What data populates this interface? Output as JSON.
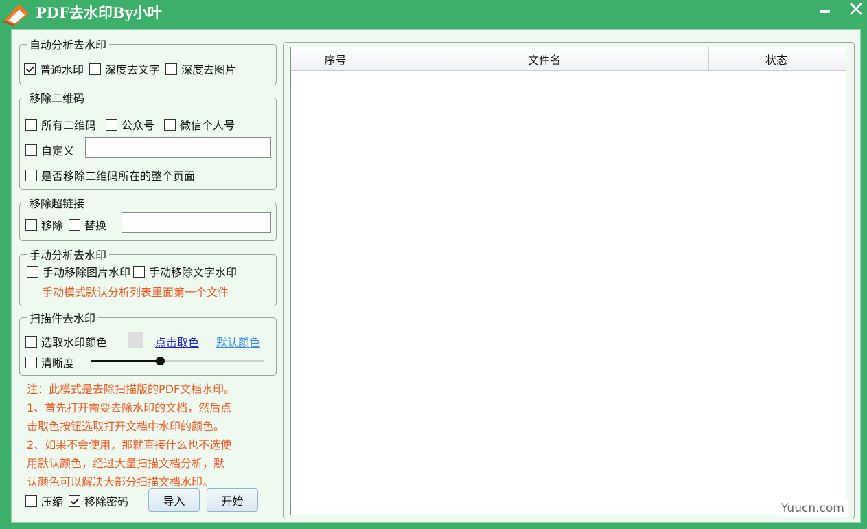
{
  "title": "PDF去水印By小叶",
  "window_controls": {
    "minimize_icon": "minimize-icon",
    "close_icon": "close-icon"
  },
  "groups": {
    "auto": {
      "legend": "自动分析去水印",
      "options": [
        {
          "label": "普通水印",
          "checked": true
        },
        {
          "label": "深度去文字",
          "checked": false
        },
        {
          "label": "深度去图片",
          "checked": false
        }
      ]
    },
    "qrcode": {
      "legend": "移除二维码",
      "options": [
        {
          "label": "所有二维码",
          "checked": false
        },
        {
          "label": "公众号",
          "checked": false
        },
        {
          "label": "微信个人号",
          "checked": false
        }
      ],
      "custom_label": "自定义",
      "custom_value": "",
      "remove_page_label": "是否移除二维码所在的整个页面"
    },
    "hyperlink": {
      "legend": "移除超链接",
      "remove_label": "移除",
      "replace_label": "替换",
      "replace_value": ""
    },
    "manual": {
      "legend": "手动分析去水印",
      "image_label": "手动移除图片水印",
      "text_label": "手动移除文字水印",
      "hint": "手动模式默认分析列表里面第一个文件"
    },
    "scan": {
      "legend": "扫描件去水印",
      "pick_color_label": "选取水印颜色",
      "swatch_color": "#dedede",
      "click_pick_link": "点击取色",
      "default_color_link": "默认颜色",
      "clarity_label": "清晰度",
      "clarity_level": 0.4
    }
  },
  "note": "注：此模式是去除扫描版的PDF文档水印。\n1、首先打开需要去除水印的文档，然后点\n击取色按钮选取打开文档中水印的颜色。\n2、如果不会使用，那就直接什么也不选使\n用默认颜色，经过大量扫描文档分析，默\n认颜色可以解决大部分扫描文档水印。",
  "bottom": {
    "compress_label": "压缩",
    "compress_checked": false,
    "remove_pwd_label": "移除密码",
    "remove_pwd_checked": true,
    "import_label": "导入",
    "start_label": "开始"
  },
  "table": {
    "columns": [
      "序号",
      "文件名",
      "状态"
    ],
    "rows": []
  },
  "watermark_text": "Yuucn.com",
  "colors": {
    "titlebar": "#3cb06a",
    "client": "#eefaf0",
    "note_text": "#ef5a24",
    "link_dark": "#1a22d8",
    "link_light": "#3a8ee6"
  }
}
